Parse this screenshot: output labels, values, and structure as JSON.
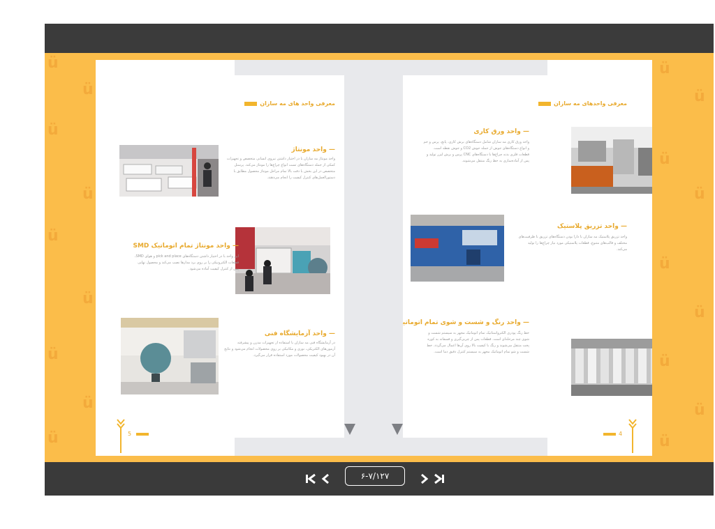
{
  "viewer": {
    "page_indicator": "۶-۷/۱۲۷",
    "accent_color": "#fbbd4a",
    "bar_color": "#3a3a3a"
  },
  "left_page": {
    "section_title": "معرفی واحد های مه سازان",
    "page_number": "5",
    "items": [
      {
        "heading": "واحد مونتاژ",
        "body": "واحد مونتاژ مه سازان با در اختیار داشتن نیروی انسانی متخصص و تجهیزات کمکی از جمله دستگاه‌های تست انواع چراغ‌ها را مونتاژ می‌کند. پرسنل متخصص در این بخش با دقت بالا تمام مراحل مونتاژ محصول مطابق با دستورالعمل‌های کنترل کیفیت را انجام می‌دهند.",
        "photo_icon": "assembly-line-photo"
      },
      {
        "heading": "واحد مونتاژ تمام اتوماتیک SMD",
        "body": "این واحد با در اختیار داشتن دستگاه‌های pick and place و هوای SMD، قطعات الکترونیکی را بر روی برد مدارها نصب می‌کند و محصول نهایی پس از کنترل کیفیت آماده می‌شود.",
        "photo_icon": "smd-line-photo"
      },
      {
        "heading": "واحد آزمایشگاه فنی",
        "body": "در آزمایشگاه فنی مه سازان با استفاده از تجهیزات مدرن و پیشرفته آزمون‌های الکتریکی، نوری و مکانیکی بر روی محصولات انجام می‌شود و نتایج آن در بهبود کیفیت محصولات مورد استفاده قرار می‌گیرد.",
        "photo_icon": "lab-integrating-sphere-photo"
      }
    ]
  },
  "right_page": {
    "section_title": "معرفی واحدهای مه سازان",
    "page_number": "4",
    "items": [
      {
        "heading": "واحد ورق کاری",
        "body": "واحد ورق کاری مه سازان شامل دستگاه‌های برش کاری، پانچ، پرس و خم و انواع دستگاه‌های جوش از جمله جوش CO2 و جوش نقطه است. قطعات فلزی بدنه چراغ‌ها با دستگاه‌های CNC پرس و برش لیزر تولید و پس از آماده‌سازی به خط رنگ منتقل می‌شوند.",
        "photo_icon": "sheet-metal-photo"
      },
      {
        "heading": "واحد تزریق پلاستیک",
        "body": "واحد تزریق پلاستیک مه سازان با دارا بودن دستگاه‌های تزریق با ظرفیت‌های مختلف و قالب‌های متنوع، قطعات پلاستیکی مورد نیاز چراغ‌ها را تولید می‌کند.",
        "photo_icon": "injection-machine-photo"
      },
      {
        "heading": "واحد رنگ و شست و شوی تمام اتوماتیک",
        "body": "خط رنگ پودری الکترواستاتیک تمام اتوماتیک مجهز به سیستم شست و شوی چند مرحله‌ای است. قطعات پس از چربی‌گیری و فسفاته به کوره پخت منتقل می‌شوند و رنگ با کیفیت بالا روی آن‌ها اعمال می‌گردد. خط شست و شو تمام اتوماتیک مجهز به سیستم کنترل دقیق دما است.",
        "photo_icon": "paint-line-photo"
      }
    ]
  }
}
